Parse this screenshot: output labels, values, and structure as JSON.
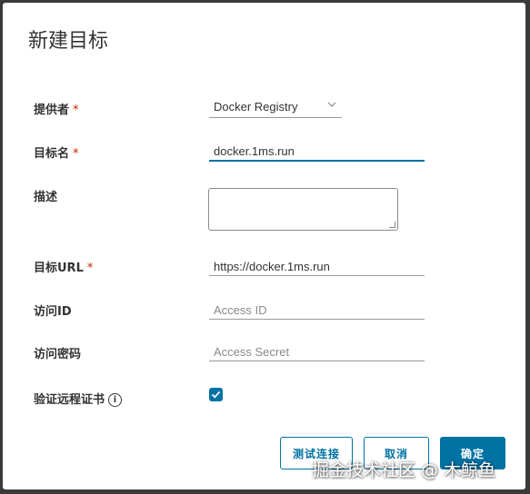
{
  "dialog": {
    "title": "新建目标"
  },
  "form": {
    "provider": {
      "label": "提供者",
      "required_mark": "*",
      "value": "Docker Registry",
      "chevron_icon": "chevron-down-icon"
    },
    "target_name": {
      "label": "目标名",
      "required_mark": "*",
      "value": "docker.1ms.run"
    },
    "description": {
      "label": "描述",
      "value": ""
    },
    "target_url": {
      "label": "目标URL",
      "required_mark": "*",
      "value": "https://docker.1ms.run"
    },
    "access_id": {
      "label": "访问ID",
      "placeholder": "Access ID"
    },
    "access_secret": {
      "label": "访问密码",
      "placeholder": "Access Secret"
    },
    "verify_cert": {
      "label": "验证远程证书",
      "info_icon": "i",
      "checked": true
    }
  },
  "buttons": {
    "test": "测试连接",
    "cancel": "取消",
    "ok": "确定"
  },
  "colors": {
    "accent": "#0072a3",
    "required": "#c92100"
  },
  "watermark": "掘金技术社区 @ 木鲸鱼"
}
